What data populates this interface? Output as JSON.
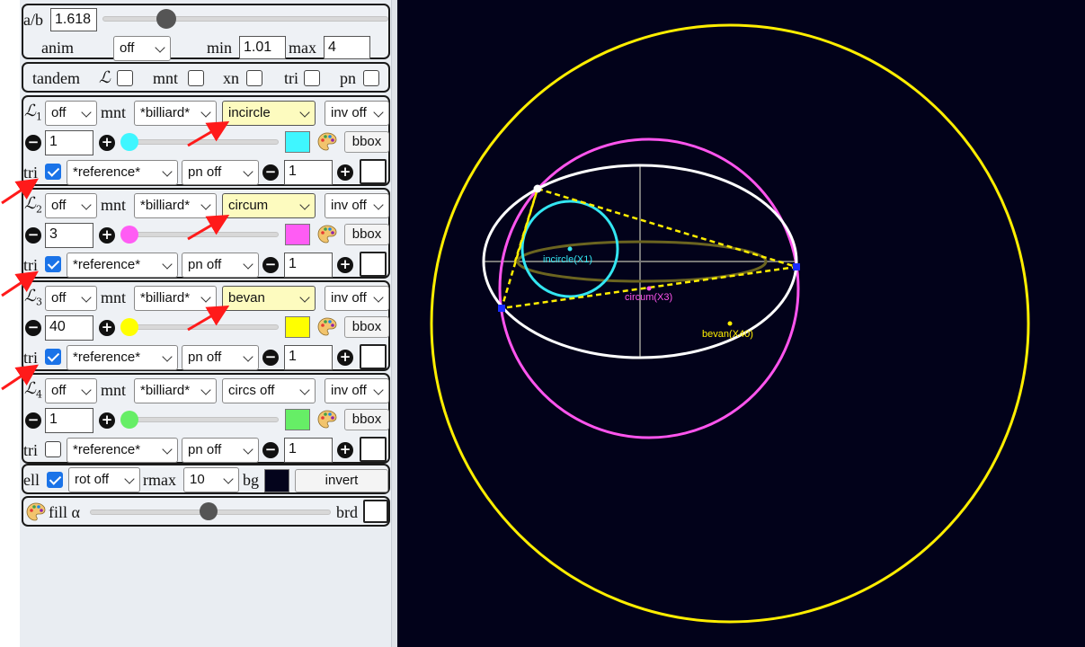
{
  "controls": {
    "ab_label": "a/b",
    "ab_value": "1.618",
    "anim_label": "anim",
    "anim_value": "off",
    "min_label": "min",
    "min_value": "1.01",
    "max_label": "max",
    "max_value": "4"
  },
  "tandem": {
    "label": "tandem",
    "L_label": "ℒ",
    "mnt_label": "mnt",
    "xn_label": "xn",
    "tri_label": "tri",
    "pn_label": "pn"
  },
  "loci": [
    {
      "symbol": "ℒ",
      "index": "1",
      "state": "off",
      "mnt_label": "mnt",
      "mount": "*billiard*",
      "center": "incircle",
      "inv": "inv off",
      "count": "1",
      "color": "#3ff6ff",
      "bbox": "bbox",
      "tri_label": "tri",
      "tri_checked": true,
      "tri_ref": "*reference*",
      "pn": "pn off",
      "pn_count": "1",
      "highlighted": true
    },
    {
      "symbol": "ℒ",
      "index": "2",
      "state": "off",
      "mnt_label": "mnt",
      "mount": "*billiard*",
      "center": "circum",
      "inv": "inv off",
      "count": "3",
      "color": "#ff5cf4",
      "bbox": "bbox",
      "tri_label": "tri",
      "tri_checked": true,
      "tri_ref": "*reference*",
      "pn": "pn off",
      "pn_count": "1",
      "highlighted": true
    },
    {
      "symbol": "ℒ",
      "index": "3",
      "state": "off",
      "mnt_label": "mnt",
      "mount": "*billiard*",
      "center": "bevan",
      "inv": "inv off",
      "count": "40",
      "color": "#ffff00",
      "bbox": "bbox",
      "tri_label": "tri",
      "tri_checked": true,
      "tri_ref": "*reference*",
      "pn": "pn off",
      "pn_count": "1",
      "highlighted": true
    },
    {
      "symbol": "ℒ",
      "index": "4",
      "state": "off",
      "mnt_label": "mnt",
      "mount": "*billiard*",
      "center": "circs off",
      "inv": "inv off",
      "count": "1",
      "color": "#66ee66",
      "bbox": "bbox",
      "tri_label": "tri",
      "tri_checked": false,
      "tri_ref": "*reference*",
      "pn": "pn off",
      "pn_count": "1",
      "highlighted": false
    }
  ],
  "ellipse_row": {
    "ell_label": "ell",
    "rot": "rot off",
    "rmax_label": "rmax",
    "rmax_value": "10",
    "bg_label": "bg",
    "bg_color": "#04041c",
    "invert_label": "invert"
  },
  "fill_row": {
    "fill_label": "fill α",
    "brd_label": "brd"
  },
  "canvas": {
    "background": "#02021a",
    "labels": {
      "incircle": "incircle(X1)",
      "circum": "circum(X3)",
      "bevan": "bevan(X40)"
    },
    "colors": {
      "ellipse": "#ffffff",
      "incircle": "#33e6f2",
      "circumcircle": "#ff55ee",
      "bevan": "#ffee00",
      "caustic": "#6b6420",
      "triangle": "#ffee00",
      "axes": "#777777",
      "vertex": "#1a2cff"
    }
  }
}
